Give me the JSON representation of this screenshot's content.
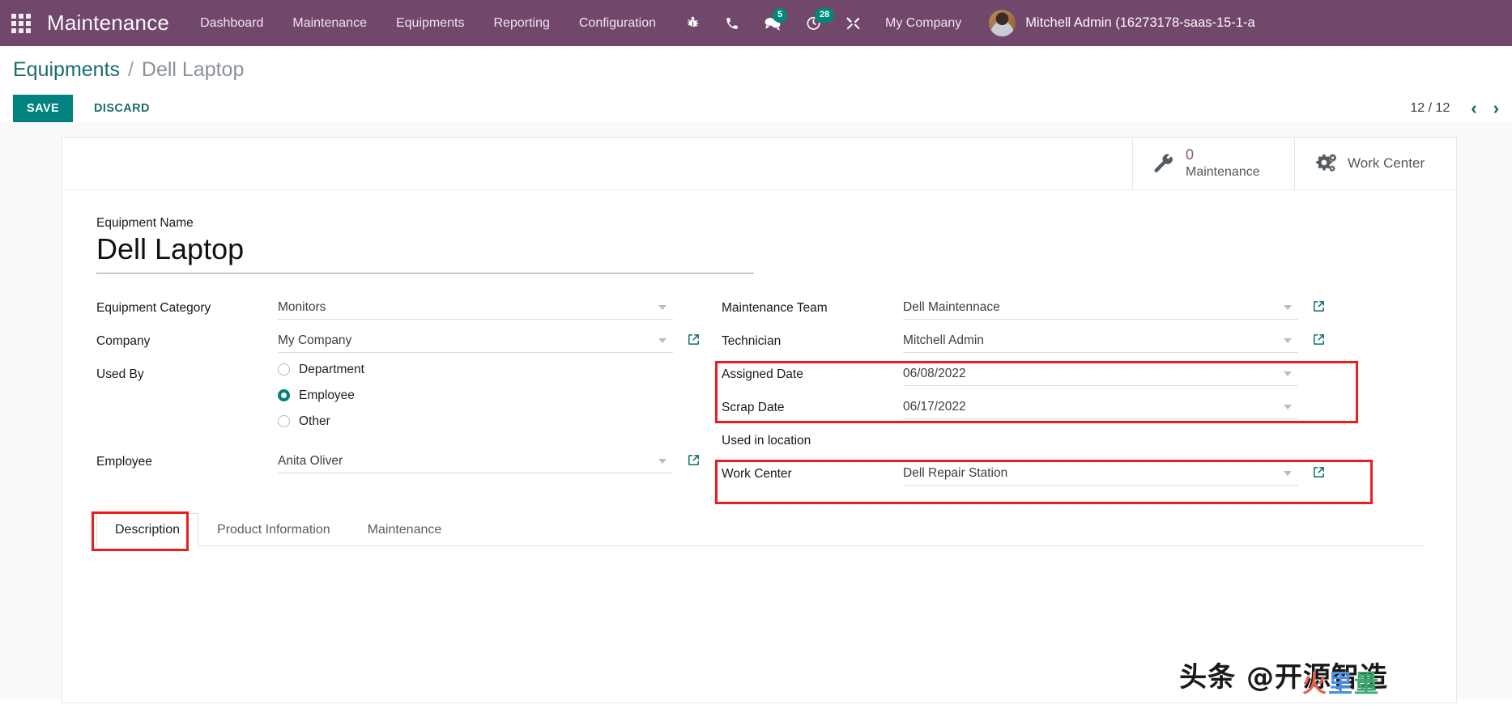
{
  "navbar": {
    "apps_icon": "apps-grid-icon",
    "brand": "Maintenance",
    "menu": [
      {
        "label": "Dashboard"
      },
      {
        "label": "Maintenance"
      },
      {
        "label": "Equipments"
      },
      {
        "label": "Reporting"
      },
      {
        "label": "Configuration"
      }
    ],
    "icons": [
      {
        "name": "bug-icon",
        "badge": ""
      },
      {
        "name": "phone-icon",
        "badge": ""
      },
      {
        "name": "messages-icon",
        "badge": "5"
      },
      {
        "name": "activities-clock-icon",
        "badge": "28"
      },
      {
        "name": "tools-icon",
        "badge": ""
      }
    ],
    "company": "My Company",
    "user_name": "Mitchell Admin (16273178-saas-15-1-a",
    "accent_teal": "#00887a",
    "bar_color": "#71476b"
  },
  "control_panel": {
    "breadcrumb_root": "Equipments",
    "breadcrumb_sep": "/",
    "breadcrumb_current": "Dell Laptop",
    "save_label": "SAVE",
    "discard_label": "DISCARD",
    "pager_value": "12 / 12",
    "pager_prev": "‹",
    "pager_next": "›"
  },
  "smart_buttons": [
    {
      "icon": "wrench-icon",
      "value": "0",
      "label": "Maintenance"
    },
    {
      "icon": "gears-icon",
      "value": "",
      "label": "Work Center"
    }
  ],
  "form": {
    "title_label": "Equipment Name",
    "title_value": "Dell Laptop",
    "left": {
      "equipment_category_label": "Equipment Category",
      "equipment_category_value": "Monitors",
      "company_label": "Company",
      "company_value": "My Company",
      "used_by_label": "Used By",
      "used_by_options": [
        {
          "label": "Department",
          "selected": false
        },
        {
          "label": "Employee",
          "selected": true
        },
        {
          "label": "Other",
          "selected": false
        }
      ],
      "employee_label": "Employee",
      "employee_value": "Anita Oliver"
    },
    "right": {
      "maintenance_team_label": "Maintenance Team",
      "maintenance_team_value": "Dell Maintennace",
      "technician_label": "Technician",
      "technician_value": "Mitchell Admin",
      "assigned_date_label": "Assigned Date",
      "assigned_date_value": "06/08/2022",
      "scrap_date_label": "Scrap Date",
      "scrap_date_value": "06/17/2022",
      "used_in_location_label": "Used in location",
      "work_center_label": "Work Center",
      "work_center_value": "Dell Repair Station"
    }
  },
  "notebook": {
    "tabs": [
      {
        "label": "Description",
        "active": true
      },
      {
        "label": "Product Information",
        "active": false
      },
      {
        "label": "Maintenance",
        "active": false
      }
    ]
  },
  "annotations": {
    "highlight_color": "#ee1d1d",
    "boxes": [
      {
        "name": "dates-highlight"
      },
      {
        "name": "work-center-highlight"
      },
      {
        "name": "description-tab-highlight"
      }
    ]
  },
  "watermark": {
    "text": "头条 @开源智造",
    "logo_1": "火",
    "logo_2": "里",
    "logo_3": "量"
  }
}
